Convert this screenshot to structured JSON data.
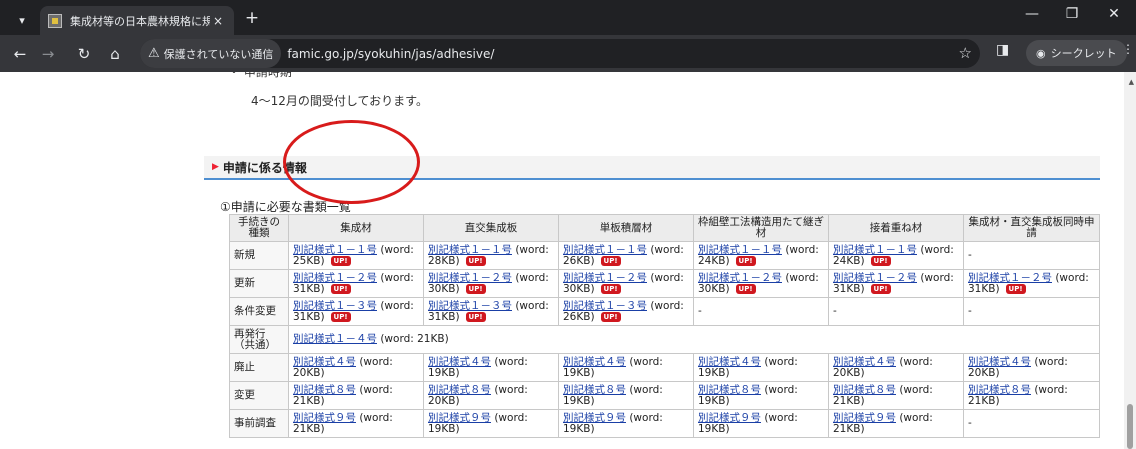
{
  "browser": {
    "tab_title": "集成材等の日本農林規格に規定",
    "tab_close": "×",
    "new_tab": "+",
    "security_label": "保護されていない通信",
    "url": "famic.go.jp/syokuhin/jas/adhesive/",
    "incognito_label": "シークレット"
  },
  "page": {
    "prev_line": "・ 申請時期",
    "accept_text": "4～12月の間受付しております。",
    "section_title": "申請に係る情報",
    "subheading": "①申請に必要な書類一覧",
    "table": {
      "headers": [
        "手続きの種類",
        "集成材",
        "直交集成板",
        "単板積層材",
        "枠組壁工法構造用たて継ぎ材",
        "接着重ね材",
        "集成材・直交集成板同時申請"
      ],
      "badge": "UP!",
      "rows": [
        {
          "label": "新規",
          "cells": [
            {
              "link": "別記様式１－１号",
              "size": "(word: 25KB)",
              "up": true
            },
            {
              "link": "別記様式１－１号",
              "size": "(word: 28KB)",
              "up": true
            },
            {
              "link": "別記様式１－１号",
              "size": "(word: 26KB)",
              "up": true
            },
            {
              "link": "別記様式１－１号",
              "size": "(word: 24KB)",
              "up": true
            },
            {
              "link": "別記様式１－１号",
              "size": "(word: 24KB)",
              "up": true
            },
            {
              "text": "-"
            }
          ]
        },
        {
          "label": "更新",
          "cells": [
            {
              "link": "別記様式１－２号",
              "size": "(word: 31KB)",
              "up": true
            },
            {
              "link": "別記様式１－２号",
              "size": "(word: 30KB)",
              "up": true
            },
            {
              "link": "別記様式１－２号",
              "size": "(word: 30KB)",
              "up": true
            },
            {
              "link": "別記様式１－２号",
              "size": "(word: 30KB)",
              "up": true
            },
            {
              "link": "別記様式１－２号",
              "size": "(word: 31KB)",
              "up": true
            },
            {
              "link": "別記様式１－２号",
              "size": "(word: 31KB)",
              "up": true
            }
          ]
        },
        {
          "label": "条件変更",
          "cells": [
            {
              "link": "別記様式１－３号",
              "size": "(word: 31KB)",
              "up": true
            },
            {
              "link": "別記様式１－３号",
              "size": "(word: 31KB)",
              "up": true
            },
            {
              "link": "別記様式１－３号",
              "size": "(word: 26KB)",
              "up": true
            },
            {
              "text": "-"
            },
            {
              "text": "-"
            },
            {
              "text": "-"
            }
          ]
        },
        {
          "label": "再発行（共通）",
          "span": {
            "link": "別記様式１－４号",
            "size": "(word: 21KB)"
          }
        },
        {
          "label": "廃止",
          "cells": [
            {
              "link": "別記様式４号",
              "size": "(word: 20KB)"
            },
            {
              "link": "別記様式４号",
              "size": "(word: 19KB)"
            },
            {
              "link": "別記様式４号",
              "size": "(word: 19KB)"
            },
            {
              "link": "別記様式４号",
              "size": "(word: 19KB)"
            },
            {
              "link": "別記様式４号",
              "size": "(word: 20KB)"
            },
            {
              "link": "別記様式４号",
              "size": "(word: 20KB)"
            }
          ]
        },
        {
          "label": "変更",
          "cells": [
            {
              "link": "別記様式８号",
              "size": "(word: 21KB)"
            },
            {
              "link": "別記様式８号",
              "size": "(word: 20KB)"
            },
            {
              "link": "別記様式８号",
              "size": "(word: 19KB)"
            },
            {
              "link": "別記様式８号",
              "size": "(word: 19KB)"
            },
            {
              "link": "別記様式８号",
              "size": "(word: 21KB)"
            },
            {
              "link": "別記様式８号",
              "size": "(word: 21KB)"
            }
          ]
        },
        {
          "label": "事前調査",
          "cells": [
            {
              "link": "別記様式９号",
              "size": "(word: 21KB)"
            },
            {
              "link": "別記様式９号",
              "size": "(word: 19KB)"
            },
            {
              "link": "別記様式９号",
              "size": "(word: 19KB)"
            },
            {
              "link": "別記様式９号",
              "size": "(word: 19KB)"
            },
            {
              "link": "別記様式９号",
              "size": "(word: 21KB)"
            },
            {
              "text": "-"
            }
          ]
        }
      ]
    }
  },
  "colors": {
    "accent": "#4e8fd1",
    "link": "#1a3fa6",
    "badge": "#d0181f",
    "annotation": "#d81b1b"
  }
}
